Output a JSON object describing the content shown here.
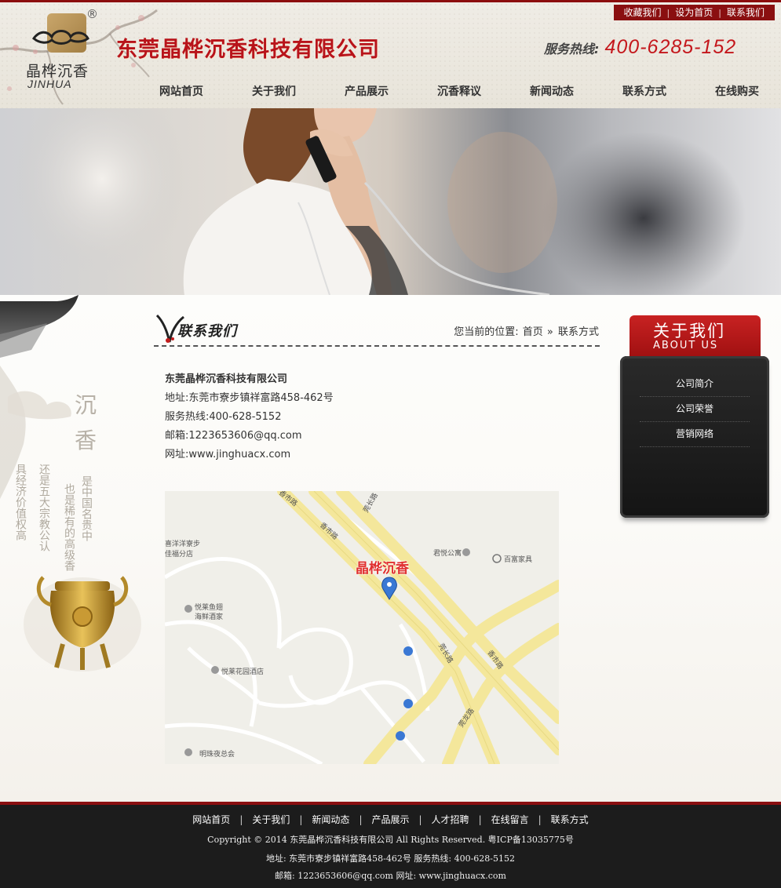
{
  "header": {
    "registered_mark": "®",
    "logo_cn": "晶桦沉香",
    "logo_en": "JINHUA",
    "company_title": "东莞晶桦沉香科技有限公司",
    "hotline_label": "服务热线:",
    "hotline_number": "400-6285-152",
    "top_links": [
      "收藏我们",
      "设为首页",
      "联系我们"
    ],
    "nav": [
      "网站首页",
      "关于我们",
      "产品展示",
      "沉香释议",
      "新闻动态",
      "联系方式",
      "在线购买"
    ]
  },
  "section": {
    "title": "联系我们",
    "breadcrumb_prefix": "您当前的位置:",
    "breadcrumb_home": "首页",
    "breadcrumb_sep": "»",
    "breadcrumb_current": "联系方式"
  },
  "contact": {
    "company": "东莞晶桦沉香科技有限公司",
    "address": "地址:东莞市寮步镇祥富路458-462号",
    "hotline": "服务热线:400-628-5152",
    "email": "邮箱:1223653606@qq.com",
    "website": "网址:www.jinghuacx.com"
  },
  "map": {
    "marker_label": "晶桦沉香",
    "road_labels": [
      "香市路",
      "香市路",
      "莞长路",
      "莞长路",
      "香市路",
      "莞龙路"
    ],
    "places": [
      "君悦公寓",
      "百富家具",
      "喜洋洋寮步",
      "佳福分店",
      "悦莱鱼翅",
      "海鲜酒家",
      "悦莱花园酒店",
      "明珠夜总会"
    ]
  },
  "sidebar": {
    "title_cn": "关于我们",
    "title_en": "ABOUT US",
    "items": [
      "公司简介",
      "公司荣誉",
      "营销网络"
    ]
  },
  "left_deco": {
    "vertical_title": "沉香",
    "poem_columns": [
      "是中国名贵中",
      "也是稀有的高级香",
      "还是五大宗教公认",
      "具经济价值"
    ]
  },
  "footer": {
    "nav": [
      "网站首页",
      "关于我们",
      "新闻动态",
      "产品展示",
      "人才招聘",
      "在线留言",
      "联系方式"
    ],
    "copyright": "Copyright © 2014  东莞晶桦沉香科技有限公司  All Rights Reserved.  粤ICP备13035775号",
    "address_line": "地址: 东莞市寮步镇祥富路458-462号  服务热线: 400-628-5152",
    "contact_line": "邮箱: 1223653606@qq.com  网址: www.jinghuacx.com"
  }
}
